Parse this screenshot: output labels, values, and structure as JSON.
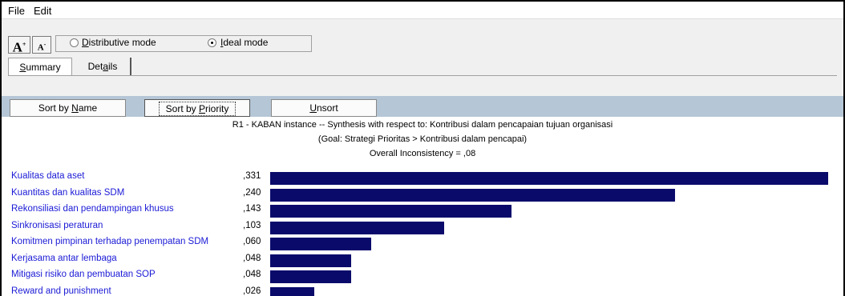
{
  "menu": {
    "file": "File",
    "edit": "Edit"
  },
  "toolbar": {
    "font_increase_icon": "font-increase-icon",
    "font_decrease_icon": "font-decrease-icon",
    "distributive_mode": "Distributive mode",
    "ideal_mode": "Ideal mode",
    "selected_mode": "Ideal mode"
  },
  "tabs": {
    "summary": "Summary",
    "details": "Details",
    "active": "Summary"
  },
  "sort": {
    "by_name": "Sort by Name",
    "by_priority": "Sort by Priority",
    "unsort": "Unsort"
  },
  "synthesis": {
    "title": "R1 - KABAN instance -- Synthesis with respect to: Kontribusi dalam pencapaian tujuan organisasi",
    "goal": "(Goal: Strategi Prioritas  > Kontribusi dalam pencapai)",
    "inconsistency": "Overall Inconsistency = ,08"
  },
  "bar_color": "#0a0a6b",
  "label_color": "#1a1ad6",
  "chart_data": {
    "type": "bar",
    "orientation": "horizontal",
    "categories": [
      "Kualitas data aset",
      "Kuantitas dan kualitas SDM",
      "Rekonsiliasi dan pendampingan khusus",
      "Sinkronisasi peraturan",
      "Komitmen pimpinan terhadap penempatan SDM",
      "Kerjasama antar lembaga",
      "Mitigasi risiko dan pembuatan SOP",
      "Reward and punishment"
    ],
    "values": [
      0.331,
      0.24,
      0.143,
      0.103,
      0.06,
      0.048,
      0.048,
      0.026
    ],
    "value_labels": [
      ",331",
      ",240",
      ",143",
      ",103",
      ",060",
      ",048",
      ",048",
      ",026"
    ],
    "xlim": [
      0,
      0.331
    ]
  }
}
